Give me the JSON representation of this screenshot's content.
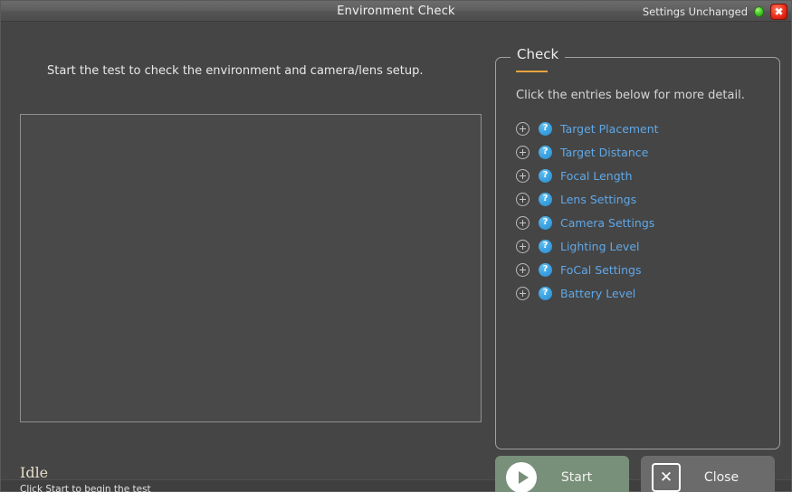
{
  "titlebar": {
    "title": "Environment Check",
    "settings_status": "Settings Unchanged",
    "status_led_color": "#4ad12a",
    "close_icon": "close-icon",
    "close_icon_glyph": "✖",
    "close_button_color": "#ee2f1d"
  },
  "left": {
    "instruction": "Start the test to check the environment and camera/lens setup.",
    "preview_placeholder": "",
    "status_title": "Idle",
    "status_subtitle": "Click Start to begin the test",
    "status_title_color": "#e6dcc8"
  },
  "check_panel": {
    "legend": "Check",
    "legend_accent_color": "#e8a33d",
    "hint": "Click the entries below for more detail.",
    "entry_link_color": "#5fa8e8",
    "entries": [
      {
        "label": "Target Placement",
        "expand_icon": "plus-circle-icon",
        "help_icon": "help-circle-icon"
      },
      {
        "label": "Target Distance",
        "expand_icon": "plus-circle-icon",
        "help_icon": "help-circle-icon"
      },
      {
        "label": "Focal Length",
        "expand_icon": "plus-circle-icon",
        "help_icon": "help-circle-icon"
      },
      {
        "label": "Lens Settings",
        "expand_icon": "plus-circle-icon",
        "help_icon": "help-circle-icon"
      },
      {
        "label": "Camera Settings",
        "expand_icon": "plus-circle-icon",
        "help_icon": "help-circle-icon"
      },
      {
        "label": "Lighting Level",
        "expand_icon": "plus-circle-icon",
        "help_icon": "help-circle-icon"
      },
      {
        "label": "FoCal Settings",
        "expand_icon": "plus-circle-icon",
        "help_icon": "help-circle-icon"
      },
      {
        "label": "Battery Level",
        "expand_icon": "plus-circle-icon",
        "help_icon": "help-circle-icon"
      }
    ],
    "help_glyph": "?"
  },
  "buttons": {
    "start_label": "Start",
    "start_icon": "play-icon",
    "start_color": "#78907a",
    "close_label": "Close",
    "close_icon": "x-square-icon",
    "close_glyph": "✕",
    "close_color": "#6b6b6b"
  }
}
